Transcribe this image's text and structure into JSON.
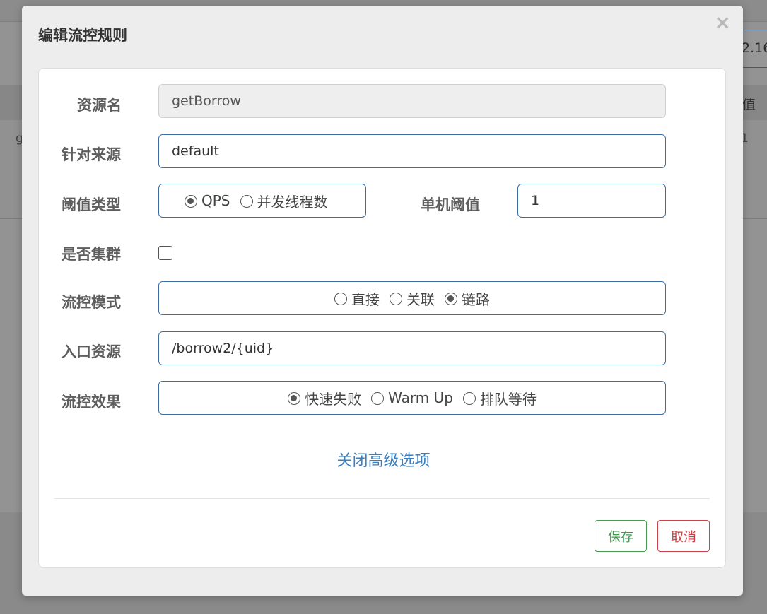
{
  "background": {
    "ip_fragment": "2.16",
    "column_header_fragment": "值",
    "row_cell_left": "g",
    "row_cell_right": "1"
  },
  "modal": {
    "title": "编辑流控规则",
    "close_icon": "×"
  },
  "form": {
    "resource_name": {
      "label": "资源名",
      "value": "getBorrow"
    },
    "limit_app": {
      "label": "针对来源",
      "value": "default"
    },
    "threshold_type": {
      "label": "阈值类型",
      "options": [
        {
          "label": "QPS",
          "selected": true
        },
        {
          "label": "并发线程数",
          "selected": false
        }
      ]
    },
    "threshold": {
      "label": "单机阈值",
      "value": "1"
    },
    "cluster": {
      "label": "是否集群",
      "checked": false
    },
    "strategy": {
      "label": "流控模式",
      "options": [
        {
          "label": "直接",
          "selected": false
        },
        {
          "label": "关联",
          "selected": false
        },
        {
          "label": "链路",
          "selected": true
        }
      ]
    },
    "entry_resource": {
      "label": "入口资源",
      "value": "/borrow2/{uid}"
    },
    "control_behavior": {
      "label": "流控效果",
      "options": [
        {
          "label": "快速失败",
          "selected": true
        },
        {
          "label": "Warm Up",
          "selected": false
        },
        {
          "label": "排队等待",
          "selected": false
        }
      ]
    },
    "advanced_toggle": "关闭高级选项"
  },
  "footer": {
    "save_label": "保存",
    "cancel_label": "取消"
  },
  "colors": {
    "input_border": "#3a6da3",
    "link": "#3b7fc1",
    "save": "#3f9a4c",
    "cancel": "#c9434a"
  }
}
